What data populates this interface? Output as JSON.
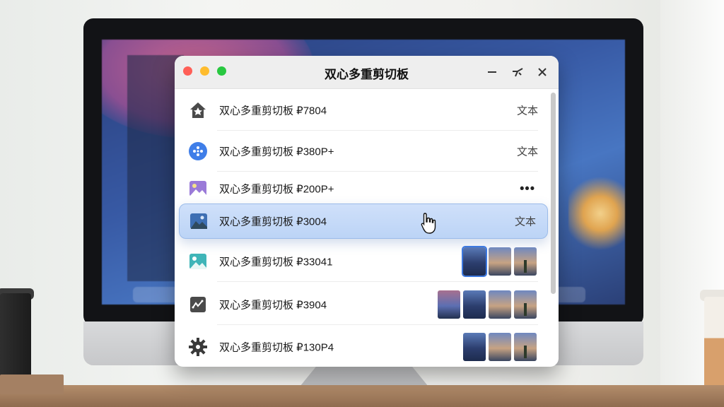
{
  "window": {
    "title": "双心多重剪切板",
    "controls": {
      "minimize_icon": "minimize-icon",
      "pin_icon": "pin-icon",
      "close_icon": "close-icon"
    }
  },
  "items": [
    {
      "icon": "home-icon",
      "label": "双心多重剪切板 ₽7804",
      "kind": "文本"
    },
    {
      "icon": "app-circle-icon",
      "label": "双心多重剪切板 ₽380P+",
      "kind": "文本"
    },
    {
      "icon": "image-purple-icon",
      "label": "双心多重剪切板 ₽200P+",
      "kind": "•••"
    },
    {
      "icon": "image-icon",
      "label": "双心多重剪切板 ₽3004",
      "kind": "文本",
      "selected": true
    },
    {
      "icon": "image-teal-icon",
      "label": "双心多重剪切板 ₽33041",
      "thumbnails": 3
    },
    {
      "icon": "chart-check-icon",
      "label": "双心多重剪切板 ₽3904",
      "thumbnails": 4
    },
    {
      "icon": "gear-icon",
      "label": "双心多重剪切板 ₽130P4",
      "thumbnails": 3
    }
  ],
  "colors": {
    "accent": "#3d79e0",
    "selection": "#c6daf8"
  }
}
